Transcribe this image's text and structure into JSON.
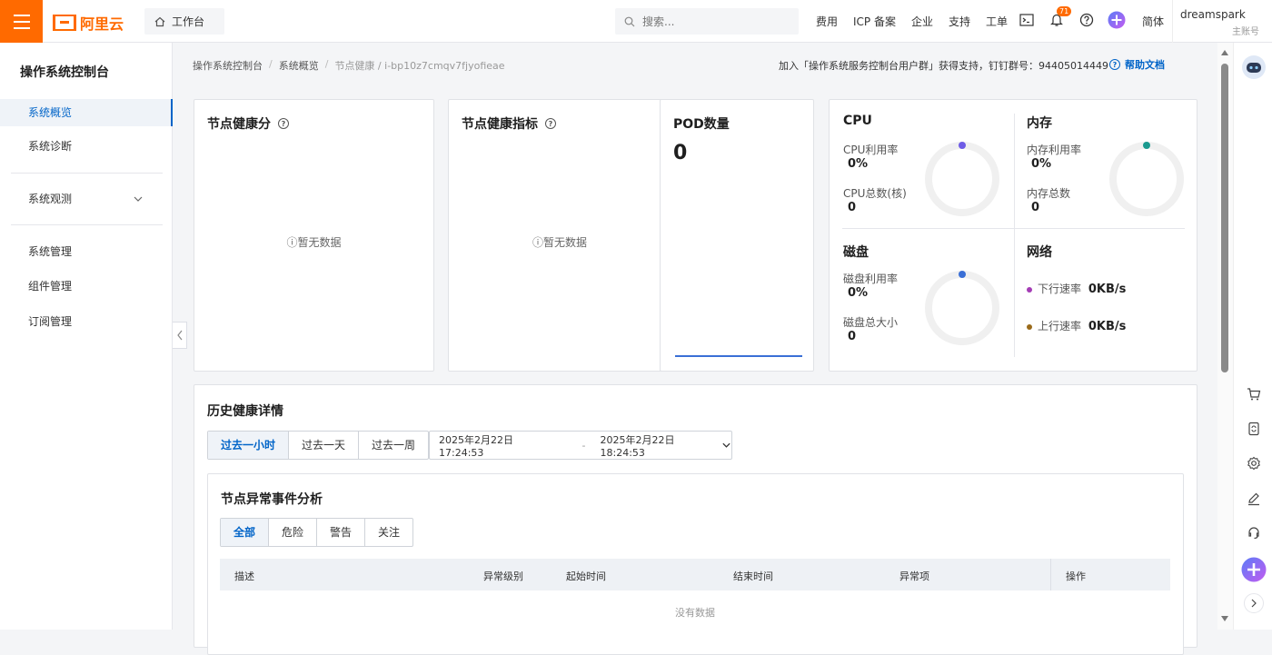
{
  "topbar": {
    "logo_text": "阿里云",
    "workbench_label": "工作台",
    "search_placeholder": "搜索...",
    "nav": [
      "费用",
      "ICP 备案",
      "企业",
      "支持",
      "工单"
    ],
    "notification_count": "71",
    "language": "简体",
    "username": "dreamspark",
    "account_type": "主账号",
    "brand_color": "#ff6a00"
  },
  "sidebar": {
    "title": "操作系统控制台",
    "items": [
      {
        "label": "系统概览",
        "active": true
      },
      {
        "label": "系统诊断",
        "active": false
      },
      {
        "label": "系统观测",
        "active": false,
        "expandable": true
      },
      {
        "label": "系统管理",
        "active": false
      },
      {
        "label": "组件管理",
        "active": false
      },
      {
        "label": "订阅管理",
        "active": false
      }
    ]
  },
  "breadcrumb": {
    "items": [
      "操作系统控制台",
      "系统概览"
    ],
    "current": "节点健康 / i-bp10z7cmqv7fjyofieae"
  },
  "help": {
    "note": "加入「操作系统服务控制台用户群」获得支持，钉钉群号：94405014449",
    "link": "帮助文档"
  },
  "cards": {
    "health_score": {
      "title": "节点健康分",
      "empty": "暂无数据"
    },
    "health_metrics": {
      "title": "节点健康指标",
      "empty": "暂无数据"
    },
    "pod": {
      "title": "POD数量",
      "value": "0"
    }
  },
  "resources": {
    "cpu": {
      "title": "CPU",
      "usage_label": "CPU利用率",
      "usage": "0%",
      "total_label": "CPU总数(核)",
      "total": "0",
      "color": "#6e5ce6"
    },
    "memory": {
      "title": "内存",
      "usage_label": "内存利用率",
      "usage": "0%",
      "total_label": "内存总数",
      "total": "0",
      "color": "#1a9a8f"
    },
    "disk": {
      "title": "磁盘",
      "usage_label": "磁盘利用率",
      "usage": "0%",
      "total_label": "磁盘总大小",
      "total": "0",
      "color": "#3a6fd6"
    },
    "network": {
      "title": "网络",
      "down_label": "下行速率",
      "down": "0KB/s",
      "up_label": "上行速率",
      "up": "0KB/s",
      "down_color": "#a43cb5",
      "up_color": "#9a6a1a"
    }
  },
  "history": {
    "title": "历史健康详情",
    "ranges": [
      "过去一小时",
      "过去一天",
      "过去一周"
    ],
    "active_range": 0,
    "start": "2025年2月22日 17:24:53",
    "separator": "-",
    "end": "2025年2月22日 18:24:53"
  },
  "events": {
    "title": "节点异常事件分析",
    "filters": [
      "全部",
      "危险",
      "警告",
      "关注"
    ],
    "active_filter": 0,
    "columns": [
      "描述",
      "异常级别",
      "起始时间",
      "结束时间",
      "异常项",
      "操作"
    ],
    "empty": "没有数据"
  }
}
